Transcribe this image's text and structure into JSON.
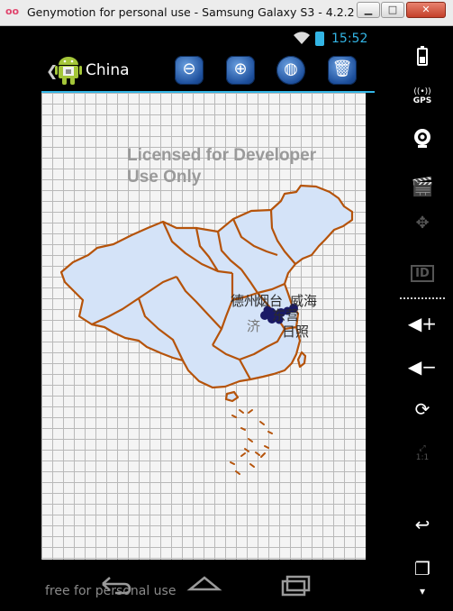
{
  "window": {
    "logo": "oo",
    "title": "Genymotion for personal use - Samsung Galaxy S3 - 4.2.2 - A...",
    "colors": {
      "logo": "#e0456d",
      "close": "#c4402a"
    }
  },
  "statusbar": {
    "time": "15:52",
    "accent": "#33b5e5"
  },
  "actionbar": {
    "title": "China",
    "icons": [
      "zoom-out-icon",
      "zoom-in-icon",
      "globe-icon",
      "trash-icon"
    ]
  },
  "map": {
    "license_line1": "Licensed for Developer",
    "license_line2": "Use Only",
    "cities": [
      "德州",
      "烟台",
      "威海",
      "东营",
      "济",
      "日照"
    ],
    "border_color": "#b5530a",
    "fill_color": "#d4e3f8",
    "marker_color": "#1a1a66"
  },
  "watermark": "free for personal use",
  "navbar": {
    "icons": [
      "back-icon",
      "home-icon",
      "recent-apps-icon"
    ]
  },
  "rail": {
    "gps_label": "GPS",
    "id_label": "ID",
    "pixel_label": "1:1",
    "icons": [
      "battery-icon",
      "gps-icon",
      "camera-icon",
      "clapper-icon",
      "dpad-icon",
      "id-icon",
      "volume-up-icon",
      "volume-down-icon",
      "rotate-icon",
      "pixel-perfect-icon",
      "back-icon",
      "recent-apps-icon",
      "menu-icon"
    ]
  }
}
